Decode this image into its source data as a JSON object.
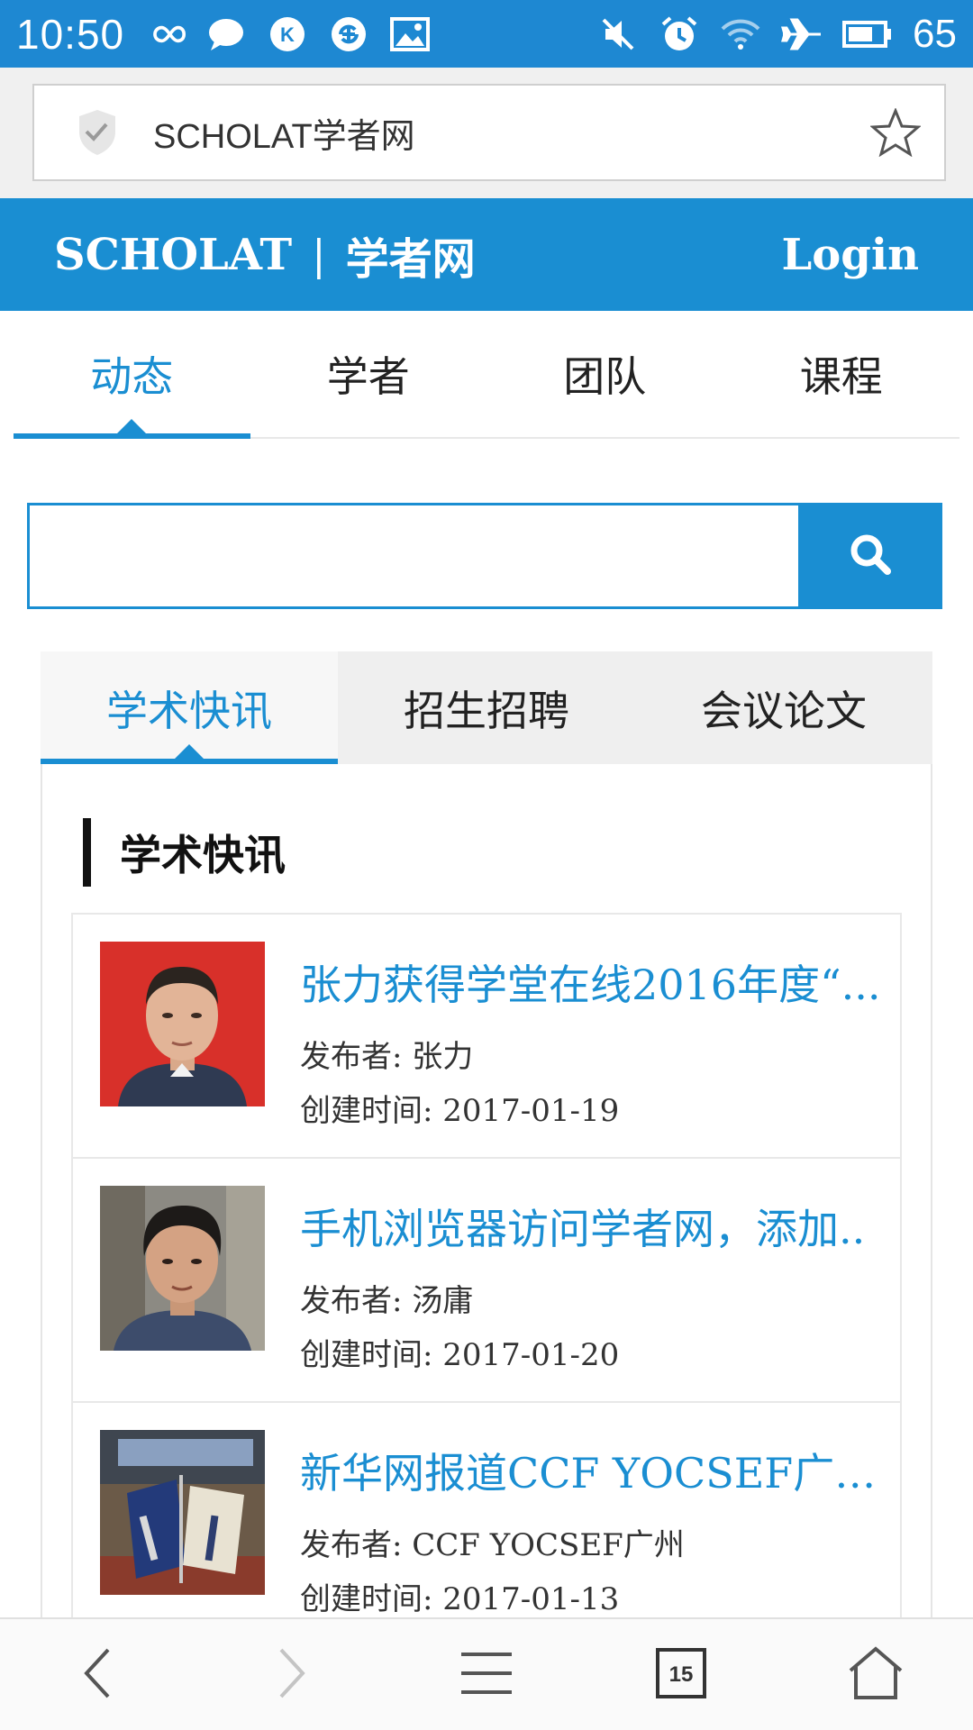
{
  "status_bar": {
    "time": "10:50",
    "battery": "65",
    "icons_left": [
      "infinity-icon",
      "chat-bubble-icon",
      "k-app-icon",
      "sync-icon",
      "image-icon"
    ],
    "icons_right": [
      "mute-icon",
      "alarm-icon",
      "wifi-icon",
      "airplane-icon",
      "battery-icon"
    ]
  },
  "browser": {
    "address": "SCHOLAT学者网",
    "tab_count": "15"
  },
  "header": {
    "brand_en": "SCHOLAT",
    "brand_sep": "|",
    "brand_cn": "学者网",
    "login": "Login"
  },
  "main_tabs": [
    {
      "label": "动态",
      "active": true
    },
    {
      "label": "学者",
      "active": false
    },
    {
      "label": "团队",
      "active": false
    },
    {
      "label": "课程",
      "active": false
    }
  ],
  "search": {
    "value": "",
    "placeholder": ""
  },
  "sub_tabs": [
    {
      "label": "学术快讯",
      "active": true
    },
    {
      "label": "招生招聘",
      "active": false
    },
    {
      "label": "会议论文",
      "active": false
    }
  ],
  "section_title": "学术快讯",
  "news": [
    {
      "title": "张力获得学堂在线2016年度“...",
      "publisher": "发布者: 张力",
      "date": "创建时间: 2017-01-19"
    },
    {
      "title": "手机浏览器访问学者网，添加..",
      "publisher": "发布者: 汤庸",
      "date": "创建时间: 2017-01-20"
    },
    {
      "title": "新华网报道CCF YOCSEF广州...",
      "publisher": "发布者: CCF YOCSEF广州",
      "date": "创建时间: 2017-01-13"
    }
  ],
  "colors": {
    "accent": "#1a8ed2",
    "status_bar": "#1e88d2"
  }
}
